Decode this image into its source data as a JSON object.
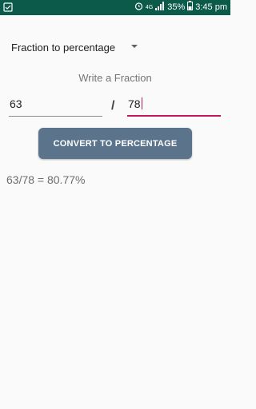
{
  "status_bar": {
    "network": "4G",
    "battery": "35%",
    "time": "3:45 pm",
    "left_icon": "app-notification-icon",
    "icons": [
      "alarm-icon",
      "signal-icon",
      "battery-icon"
    ]
  },
  "spinner": {
    "selected": "Fraction to percentage"
  },
  "prompt": "Write a Fraction",
  "inputs": {
    "numerator": "63",
    "denominator": "78",
    "separator": "/"
  },
  "button": {
    "label": "CONVERT TO PERCENTAGE"
  },
  "result": "63/78 = 80.77%",
  "colors": {
    "status_bar": "#0b5a4a",
    "accent": "#c2185b",
    "button": "#5b748b"
  }
}
